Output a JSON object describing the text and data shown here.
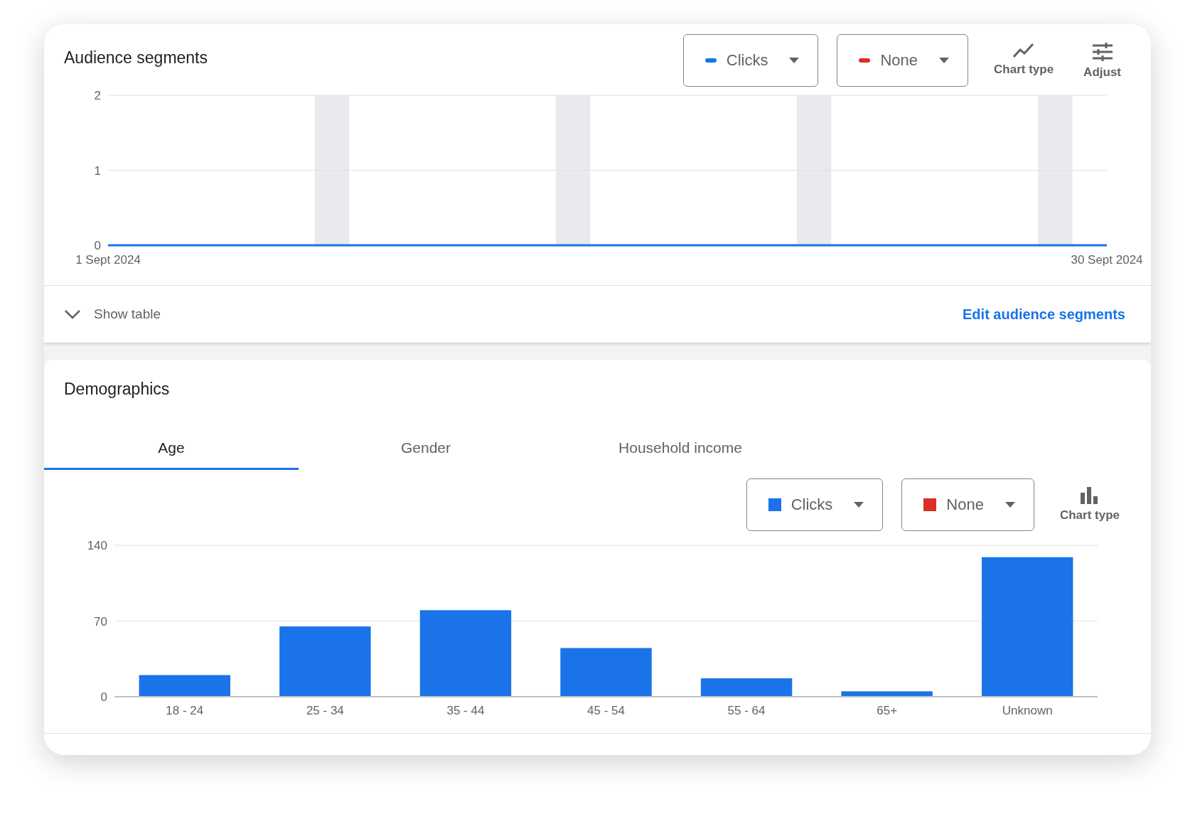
{
  "audience_segments": {
    "title": "Audience segments",
    "metrics": [
      {
        "label": "Clicks",
        "color": "#1a73e8"
      },
      {
        "label": "None",
        "color": "#d93025"
      }
    ],
    "tools": [
      {
        "kind": "chart",
        "label": "Chart type"
      },
      {
        "kind": "adjust",
        "label": "Adjust"
      }
    ],
    "chart_data": {
      "type": "line",
      "categories": [
        "1 Sept 2024",
        null,
        null,
        null,
        null,
        null,
        null,
        null,
        null,
        null,
        null,
        null,
        null,
        null,
        null,
        null,
        null,
        null,
        null,
        null,
        null,
        null,
        null,
        null,
        null,
        null,
        null,
        null,
        null,
        "30 Sept 2024"
      ],
      "ylim": [
        0,
        2
      ],
      "yticks": [
        0,
        1,
        2
      ],
      "series": [
        {
          "color": "#1a73e8",
          "values": [
            0,
            0,
            0,
            0,
            0,
            0,
            0,
            0,
            0,
            0,
            0,
            0,
            0,
            0,
            0,
            0,
            0,
            0,
            0,
            0,
            0,
            0,
            0,
            0,
            0,
            0,
            0,
            0,
            0,
            0
          ]
        }
      ]
    },
    "show_table": "Show table",
    "edit_link": "Edit audience segments"
  },
  "demographics": {
    "title": "Demographics",
    "tabs": [
      {
        "label": "Age",
        "selected": true
      },
      {
        "label": "Gender",
        "selected": false
      },
      {
        "label": "Household income",
        "selected": false
      }
    ],
    "metrics": [
      {
        "label": "Clicks",
        "color": "#1a73e8"
      },
      {
        "label": "None",
        "color": "#d93025"
      }
    ],
    "tools": [
      {
        "kind": "bars",
        "label": "Chart type"
      }
    ],
    "chart_data": {
      "type": "bar",
      "categories": [
        "18 - 24",
        "25 - 34",
        "35 - 44",
        "45 - 54",
        "55 - 64",
        "65+",
        "Unknown"
      ],
      "ylim": [
        0,
        140
      ],
      "yticks": [
        0,
        70,
        140
      ],
      "series": [
        {
          "color": "#1a73e8",
          "values": [
            20,
            65,
            80,
            45,
            17,
            5,
            129
          ]
        }
      ]
    }
  }
}
